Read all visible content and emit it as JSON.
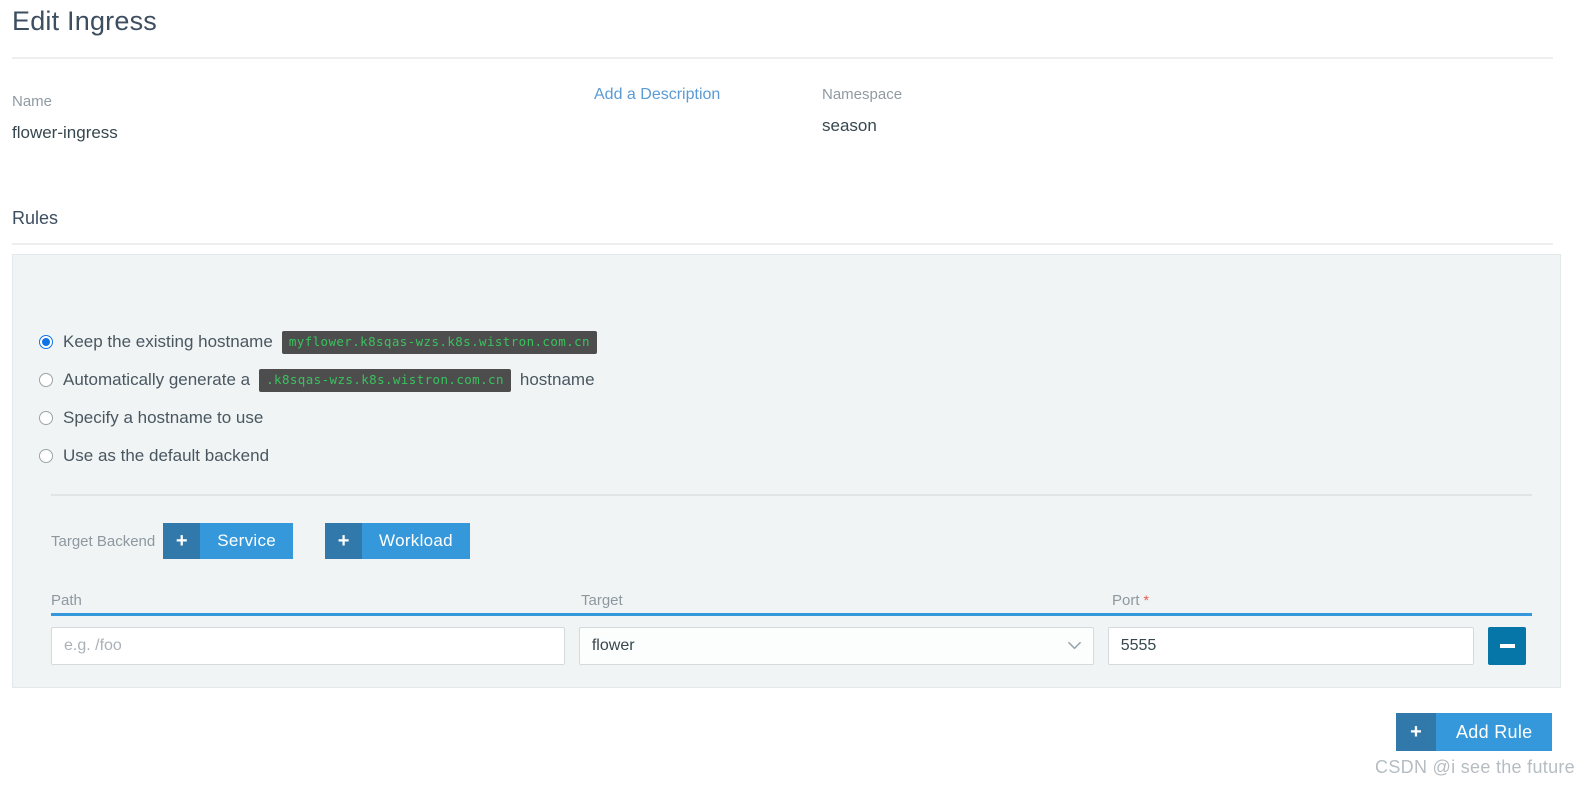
{
  "page": {
    "title": "Edit Ingress"
  },
  "meta": {
    "name_label": "Name",
    "name_value": "flower-ingress",
    "description_link": "Add a Description",
    "namespace_label": "Namespace",
    "namespace_value": "season"
  },
  "rules": {
    "section_title": "Rules",
    "options": [
      {
        "id": "keep-existing-hostname",
        "selected": true,
        "text_before": "Keep the existing hostname",
        "code": "myflower.k8sqas-wzs.k8s.wistron.com.cn",
        "text_after": ""
      },
      {
        "id": "auto-generate-hostname",
        "selected": false,
        "text_before": "Automatically generate a",
        "code": ".k8sqas-wzs.k8s.wistron.com.cn",
        "text_after": "hostname"
      },
      {
        "id": "specify-hostname",
        "selected": false,
        "text_before": "Specify a hostname to use",
        "code": "",
        "text_after": ""
      },
      {
        "id": "default-backend",
        "selected": false,
        "text_before": "Use as the default backend",
        "code": "",
        "text_after": ""
      }
    ],
    "target_backend": {
      "label": "Target Backend",
      "buttons": [
        {
          "icon": "plus-icon",
          "glyph": "+",
          "label": "Service"
        },
        {
          "icon": "plus-icon",
          "glyph": "+",
          "label": "Workload"
        }
      ]
    },
    "table": {
      "columns": [
        {
          "key": "path",
          "label": "Path",
          "required": false
        },
        {
          "key": "target",
          "label": "Target",
          "required": false
        },
        {
          "key": "port",
          "label": "Port",
          "required": true,
          "required_mark": "*"
        }
      ],
      "row": {
        "path_value": "",
        "path_placeholder": "e.g. /foo",
        "target_value": "flower",
        "target_icon": "chevron-down-icon",
        "port_value": "5555",
        "port_placeholder": "",
        "remove_icon": "minus-icon"
      }
    },
    "add_rule": {
      "icon": "plus-icon",
      "glyph": "+",
      "label": "Add Rule"
    }
  },
  "watermark": {
    "text": "CSDN @i see the future"
  },
  "colors": {
    "accent_blue": "#3498db",
    "accent_blue_dark": "#3279ab",
    "radio_selected": "#1273e6",
    "remove_button": "#0676a8",
    "code_bg": "#4d4d4d",
    "code_fg": "#3ac25e",
    "panel_bg": "#f0f4f5",
    "required_star": "#e8584f",
    "link": "#5b9ad5"
  }
}
